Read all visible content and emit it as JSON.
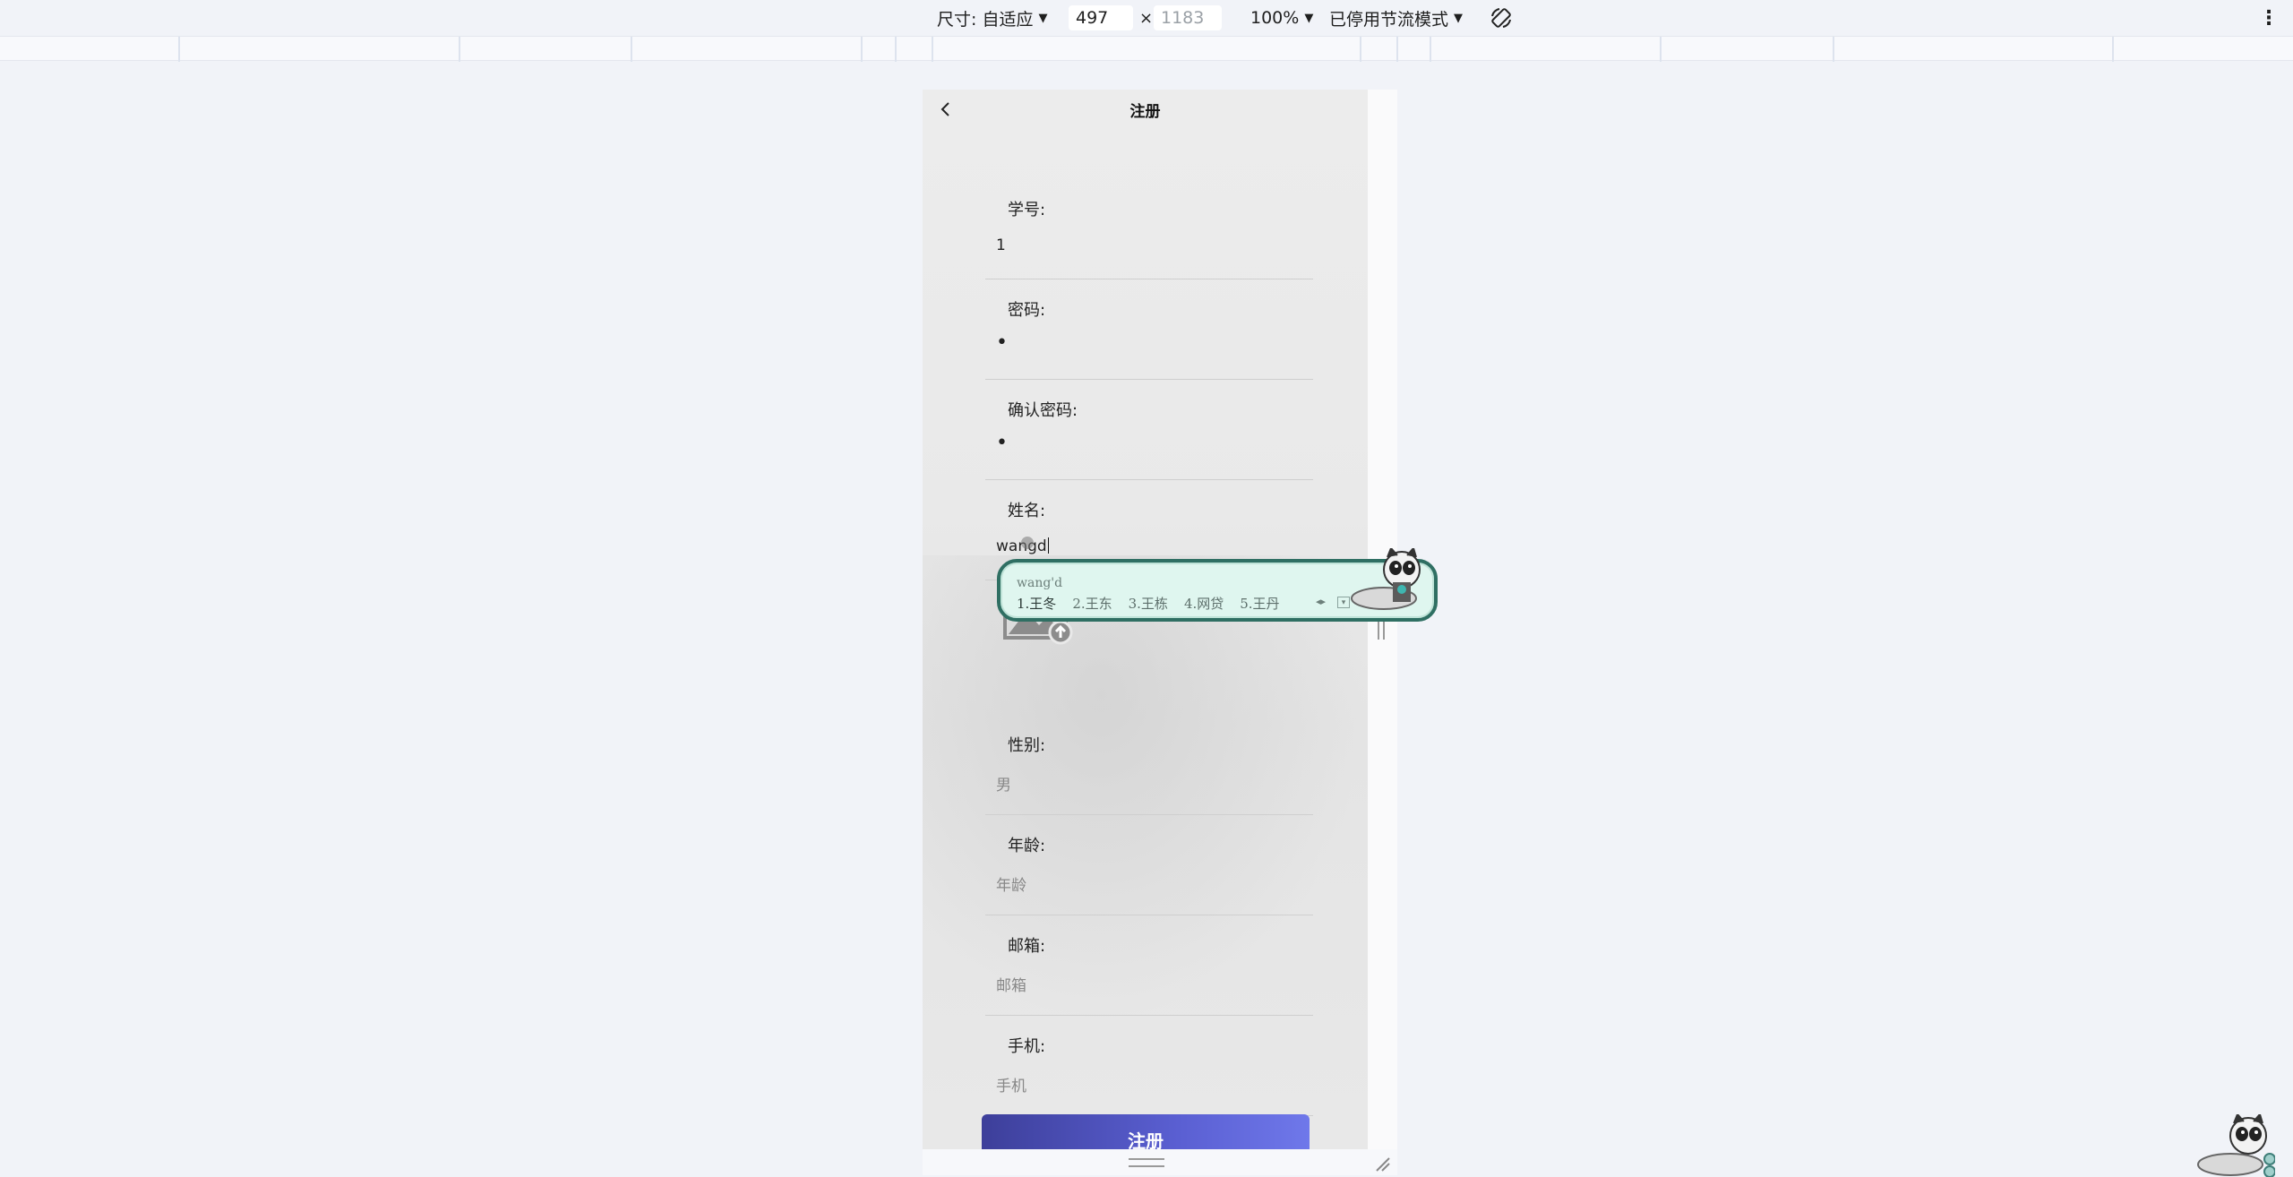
{
  "devtools": {
    "size_label": "尺寸: 自适应",
    "width": "497",
    "height_placeholder": "1183",
    "times": "×",
    "zoom": "100%",
    "throttle": "已停用节流模式",
    "more": "⋮"
  },
  "page": {
    "title": "注册",
    "fields": [
      {
        "label": "学号:",
        "value": "1"
      },
      {
        "label": "密码:",
        "value": "•"
      },
      {
        "label": "确认密码:",
        "value": "•"
      },
      {
        "label": "姓名:",
        "value": "wangd"
      },
      {
        "label": "性别:",
        "value": "男"
      },
      {
        "label": "年龄:",
        "placeholder": "年龄"
      },
      {
        "label": "邮箱:",
        "placeholder": "邮箱"
      },
      {
        "label": "手机:",
        "placeholder": "手机"
      }
    ],
    "submit_label": "注册"
  },
  "ime": {
    "composition": "wang'd",
    "candidates": [
      "1.王冬",
      "2.王东",
      "3.王栋",
      "4.网贷",
      "5.王丹"
    ],
    "expand": "▾"
  },
  "colors": {
    "button_start": "#3d3f9a",
    "button_end": "#6f78ea",
    "ime_border": "#2f6f63",
    "ime_bg": "#dff6ef"
  }
}
